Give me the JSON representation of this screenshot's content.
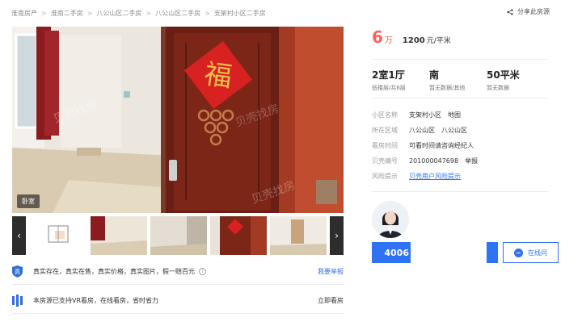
{
  "breadcrumb": [
    "淮南房产",
    "淮南二手房",
    "八公山区二手房",
    "八公山区二手房",
    "支架村小区二手房"
  ],
  "share_label": "分享此房源",
  "watermark": "贝壳找房",
  "main_photo": {
    "room_tag": "卧室"
  },
  "thumbnails": {
    "prev": "‹",
    "next": "›"
  },
  "features": [
    {
      "text": "真实存在，真实在售，真实价格，真实图片，假一赔百元",
      "info": "i",
      "link": "我要举报"
    },
    {
      "text": "本房源已支持VR看房，在线看房，省时省力",
      "link": "立即看房"
    }
  ],
  "price": {
    "total": "6",
    "total_unit": "万",
    "per_sqm": "1200",
    "per_sqm_unit": "元/平米"
  },
  "facts": [
    {
      "main": "2室1厅",
      "sub": "低楼层/共6层"
    },
    {
      "main": "南",
      "sub": "暂无数据/其他"
    },
    {
      "main": "50平米",
      "sub": "暂无数据"
    }
  ],
  "details": {
    "community": {
      "label": "小区名称",
      "value": "支架村小区",
      "extra": "地图"
    },
    "area": {
      "label": "所在区域",
      "value": "八公山区",
      "extra": "八公山区"
    },
    "viewing": {
      "label": "看房时间",
      "value": "可看时间请咨询经纪人"
    },
    "id": {
      "label": "贝壳编号",
      "value": "201000047698",
      "extra": "举报"
    },
    "risk": {
      "label": "风险提示",
      "value": "贝壳用户风险提示"
    }
  },
  "agent": {
    "phone_prefix": "4006",
    "online_label": "在线问"
  },
  "colors": {
    "price": "#fe615a",
    "accent": "#3072f6",
    "door": "#6b1f14"
  }
}
